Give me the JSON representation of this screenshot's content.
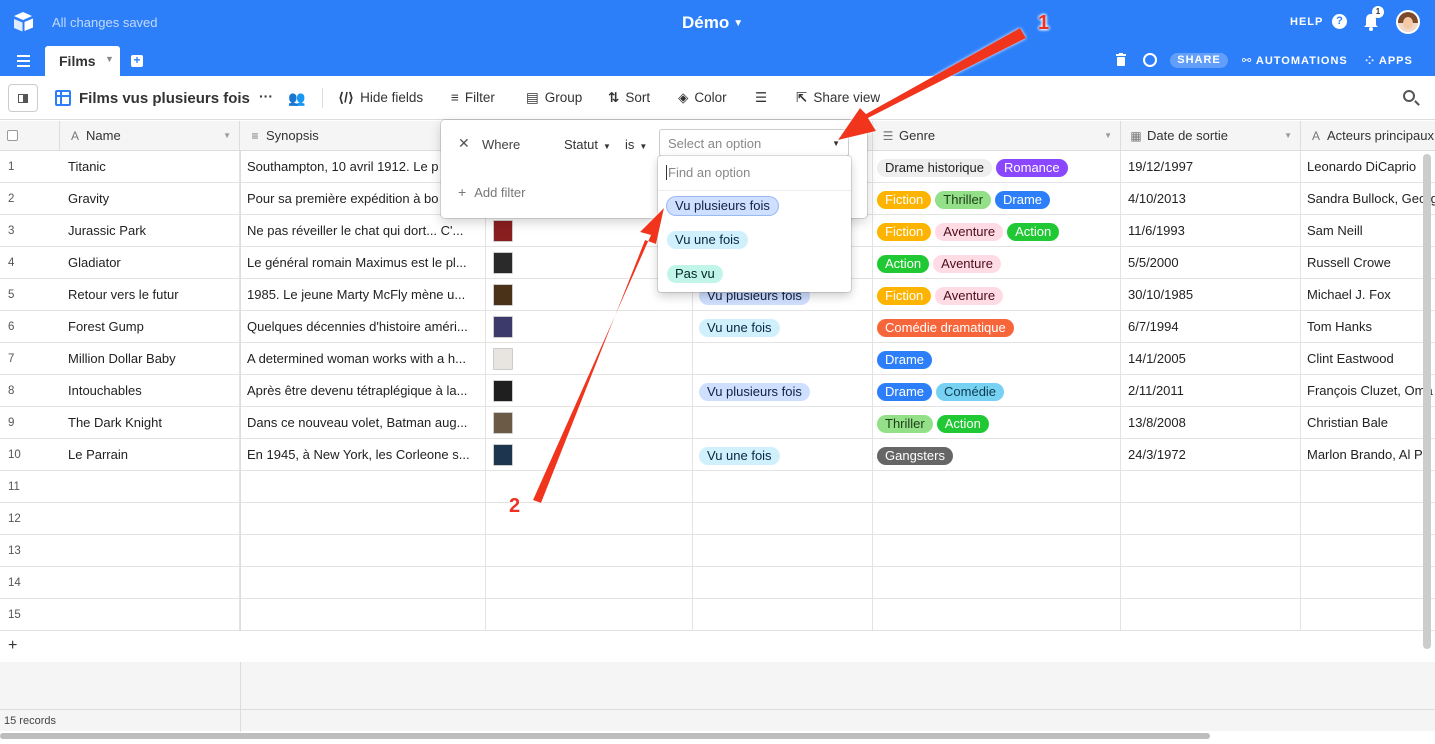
{
  "topbar": {
    "status": "All changes saved",
    "base_name": "Démo",
    "help": "HELP",
    "help_icon": "?",
    "notifications_count": "1",
    "share": "SHARE",
    "automations": "AUTOMATIONS",
    "apps": "APPS"
  },
  "tabs": [
    {
      "label": "Films"
    }
  ],
  "viewbar": {
    "view_name": "Films vus plusieurs fois",
    "more": "···",
    "hide_fields": "Hide fields",
    "filter": "Filter",
    "group": "Group",
    "sort": "Sort",
    "color": "Color",
    "share_view": "Share view"
  },
  "columns": {
    "name": "Name",
    "synopsis": "Synopsis",
    "genre": "Genre",
    "date": "Date de sortie",
    "actors": "Acteurs principaux"
  },
  "rows": [
    {
      "n": "1",
      "name": "Titanic",
      "synopsis": "Southampton, 10 avril 1912. Le p",
      "statut": "",
      "genres": [
        "Drame historique",
        "Romance"
      ],
      "date": "19/12/1997",
      "actors": "Leonardo DiCaprio"
    },
    {
      "n": "2",
      "name": "Gravity",
      "synopsis": "Pour sa première expédition à bo",
      "statut": "",
      "genres": [
        "Fiction",
        "Thriller",
        "Drame"
      ],
      "date": "4/10/2013",
      "actors": "Sandra Bullock, Georg"
    },
    {
      "n": "3",
      "name": "Jurassic Park",
      "synopsis": "Ne pas réveiller le chat qui dort... C'...",
      "statut": "",
      "genres": [
        "Fiction",
        "Aventure",
        "Action"
      ],
      "date": "11/6/1993",
      "actors": "Sam Neill"
    },
    {
      "n": "4",
      "name": "Gladiator",
      "synopsis": "Le général romain Maximus est le pl...",
      "statut": "",
      "genres": [
        "Action",
        "Aventure"
      ],
      "date": "5/5/2000",
      "actors": "Russell Crowe"
    },
    {
      "n": "5",
      "name": "Retour vers le futur",
      "synopsis": "1985. Le jeune Marty McFly mène u...",
      "statut": "Vu plusieurs fois",
      "genres": [
        "Fiction",
        "Aventure"
      ],
      "date": "30/10/1985",
      "actors": "Michael J. Fox"
    },
    {
      "n": "6",
      "name": "Forest Gump",
      "synopsis": "Quelques décennies d'histoire améri...",
      "statut": "Vu une fois",
      "genres": [
        "Comédie dramatique"
      ],
      "date": "6/7/1994",
      "actors": "Tom Hanks"
    },
    {
      "n": "7",
      "name": "Million Dollar Baby",
      "synopsis": "A determined woman works with a h...",
      "statut": "",
      "genres": [
        "Drame"
      ],
      "date": "14/1/2005",
      "actors": "Clint Eastwood"
    },
    {
      "n": "8",
      "name": "Intouchables",
      "synopsis": "Après être devenu tétraplégique à la...",
      "statut": "Vu plusieurs fois",
      "genres": [
        "Drame",
        "Comédie"
      ],
      "date": "2/11/2011",
      "actors": "François Cluzet, Oma"
    },
    {
      "n": "9",
      "name": "The Dark Knight",
      "synopsis": "Dans ce nouveau volet, Batman aug...",
      "statut": "",
      "genres": [
        "Thriller",
        "Action"
      ],
      "date": "13/8/2008",
      "actors": "Christian Bale"
    },
    {
      "n": "10",
      "name": "Le Parrain",
      "synopsis": "En 1945, à New York, les Corleone s...",
      "statut": "Vu une fois",
      "genres": [
        "Gangsters"
      ],
      "date": "24/3/1972",
      "actors": "Marlon Brando, Al Pa"
    },
    {
      "n": "11"
    },
    {
      "n": "12"
    },
    {
      "n": "13"
    },
    {
      "n": "14"
    },
    {
      "n": "15"
    }
  ],
  "genre_colors": {
    "Drame historique": {
      "bg": "#eeeeee",
      "fg": "#222222"
    },
    "Romance": {
      "bg": "#8b46ff",
      "fg": "#ffffff"
    },
    "Fiction": {
      "bg": "#fcb400",
      "fg": "#ffffff"
    },
    "Thriller": {
      "bg": "#93e088",
      "fg": "#1d3d18"
    },
    "Drame": {
      "bg": "#2d7ff9",
      "fg": "#ffffff"
    },
    "Aventure": {
      "bg": "#ffdce5",
      "fg": "#4c0c1c"
    },
    "Action": {
      "bg": "#20c933",
      "fg": "#ffffff"
    },
    "Comédie dramatique": {
      "bg": "#f7653b",
      "fg": "#ffffff"
    },
    "Comédie": {
      "bg": "#77d1f3",
      "fg": "#0b3c4e"
    },
    "Gangsters": {
      "bg": "#666666",
      "fg": "#ffffff"
    }
  },
  "statut_colors": {
    "Vu plusieurs fois": {
      "bg": "#cfdfff",
      "fg": "#102046"
    },
    "Vu une fois": {
      "bg": "#d0f0fd",
      "fg": "#04283f"
    },
    "Pas vu": {
      "bg": "#c2f5e9",
      "fg": "#012524"
    }
  },
  "filter": {
    "where": "Where",
    "field": "Statut",
    "operator": "is",
    "placeholder": "Select an option",
    "add_filter": "Add filter",
    "find_placeholder": "Find an option",
    "options": [
      "Vu plusieurs fois",
      "Vu une fois",
      "Pas vu"
    ]
  },
  "footer": {
    "records": "15 records"
  },
  "annotations": {
    "label1": "1",
    "label2": "2"
  },
  "icons": [
    "airtable-logo-icon",
    "help-icon",
    "bell-icon",
    "avatar",
    "hamburger-icon",
    "add-tab-icon",
    "trash-icon",
    "history-icon",
    "automations-icon",
    "apps-icon",
    "sidebar-toggle-icon",
    "grid-view-icon",
    "collaborators-icon",
    "hide-fields-icon",
    "filter-icon",
    "group-icon",
    "sort-icon",
    "color-icon",
    "row-height-icon",
    "share-view-icon",
    "search-icon"
  ]
}
